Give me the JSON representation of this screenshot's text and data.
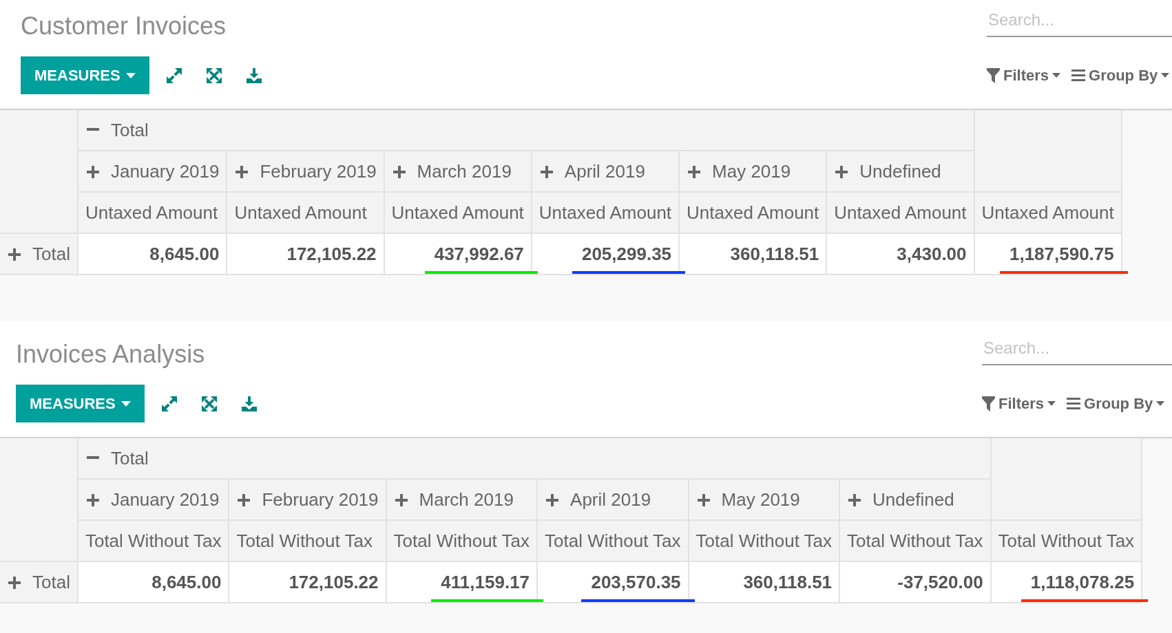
{
  "views": [
    {
      "title": "Customer Invoices",
      "search": {
        "placeholder": "Search..."
      },
      "measures_button": "MEASURES",
      "filters_button": "Filters",
      "group_by_button": "Group By",
      "pivot": {
        "header": {
          "label": "Total",
          "expanded": true
        },
        "columns": [
          {
            "label": "January 2019",
            "expanded": false
          },
          {
            "label": "February 2019",
            "expanded": false
          },
          {
            "label": "March 2019",
            "expanded": false
          },
          {
            "label": "April 2019",
            "expanded": false
          },
          {
            "label": "May 2019",
            "expanded": false
          },
          {
            "label": "Undefined",
            "expanded": false
          }
        ],
        "measures": [
          "Untaxed Amount",
          "Untaxed Amount",
          "Untaxed Amount",
          "Untaxed Amount",
          "Untaxed Amount",
          "Untaxed Amount",
          "Untaxed Amount"
        ],
        "rows": [
          {
            "label": "Total",
            "expanded": false,
            "cells": [
              {
                "value": "8,645.00"
              },
              {
                "value": "172,105.22"
              },
              {
                "value": "437,992.67",
                "color": "#00ee00"
              },
              {
                "value": "205,299.35",
                "color": "#0a3cff"
              },
              {
                "value": "360,118.51"
              },
              {
                "value": "3,430.00"
              },
              {
                "value": "1,187,590.75",
                "color": "#ff2a00"
              }
            ]
          }
        ]
      }
    },
    {
      "title": "Invoices Analysis",
      "search": {
        "placeholder": "Search..."
      },
      "measures_button": "MEASURES",
      "filters_button": "Filters",
      "group_by_button": "Group By",
      "pivot": {
        "header": {
          "label": "Total",
          "expanded": true
        },
        "columns": [
          {
            "label": "January 2019",
            "expanded": false
          },
          {
            "label": "February 2019",
            "expanded": false
          },
          {
            "label": "March 2019",
            "expanded": false
          },
          {
            "label": "April 2019",
            "expanded": false
          },
          {
            "label": "May 2019",
            "expanded": false
          },
          {
            "label": "Undefined",
            "expanded": false
          }
        ],
        "measures": [
          "Total Without Tax",
          "Total Without Tax",
          "Total Without Tax",
          "Total Without Tax",
          "Total Without Tax",
          "Total Without Tax",
          "Total Without Tax"
        ],
        "rows": [
          {
            "label": "Total",
            "expanded": false,
            "cells": [
              {
                "value": "8,645.00"
              },
              {
                "value": "172,105.22"
              },
              {
                "value": "411,159.17",
                "color": "#00ee00"
              },
              {
                "value": "203,570.35",
                "color": "#0a3cff"
              },
              {
                "value": "360,118.51"
              },
              {
                "value": "-37,520.00"
              },
              {
                "value": "1,118,078.25",
                "color": "#ff2a00"
              }
            ]
          }
        ]
      }
    }
  ]
}
